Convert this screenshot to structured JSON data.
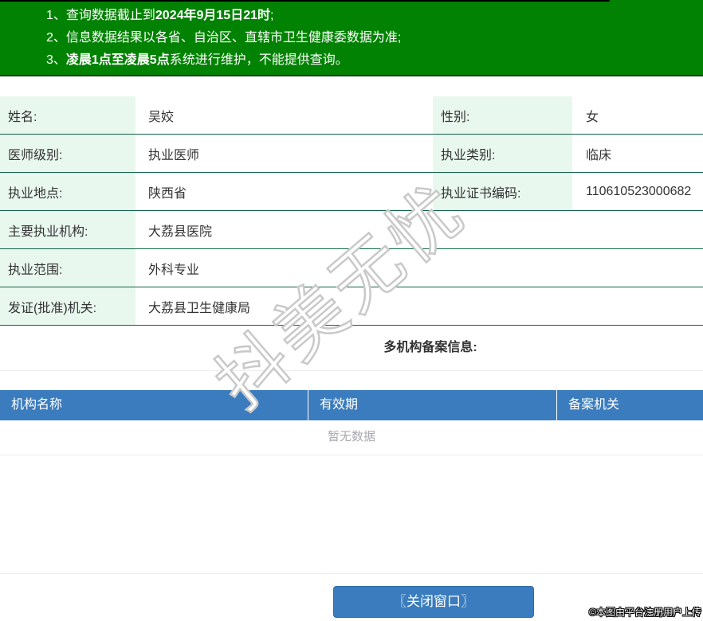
{
  "colors": {
    "banner_green": "#028202",
    "row_line": "#0f6148",
    "label_bg": "#e9f8ef",
    "header_blue": "#3a7cbd",
    "button_blue": "#3a7cbd"
  },
  "banner": {
    "lines": [
      {
        "pre": "1、查询数据截止到",
        "bold": "2024年9月15日21时",
        "post": ";"
      },
      {
        "pre": "2、信息数据结果以各省、自治区、直辖市卫生健康委数据为准;",
        "bold": "",
        "post": ""
      },
      {
        "pre": "3、",
        "bold": "凌晨1点至凌晨5点",
        "post": "系统进行维护，不能提供查询。"
      }
    ]
  },
  "info": {
    "rows": [
      {
        "label1": "姓名:",
        "value1": "吴姣",
        "label2": "性别:",
        "value2": "女"
      },
      {
        "label1": "医师级别:",
        "value1": "执业医师",
        "label2": "执业类别:",
        "value2": "临床"
      },
      {
        "label1": "执业地点:",
        "value1": "陕西省",
        "label2": "执业证书编码:",
        "value2": "110610523000682"
      },
      {
        "label": "主要执业机构:",
        "value": "大荔县医院"
      },
      {
        "label": "执业范围:",
        "value": "外科专业"
      },
      {
        "label": "发证(批准)机关:",
        "value": "大荔县卫生健康局"
      }
    ]
  },
  "multi_section": {
    "title": "多机构备案信息:"
  },
  "org_table": {
    "headers": [
      "机构名称",
      "有效期",
      "备案机关"
    ],
    "empty_text": "暂无数据"
  },
  "footer": {
    "close_button": "〖关闭窗口〗",
    "copyright": "©本图由平台注册用户上传"
  },
  "watermark": {
    "text": "抖美无忧"
  }
}
